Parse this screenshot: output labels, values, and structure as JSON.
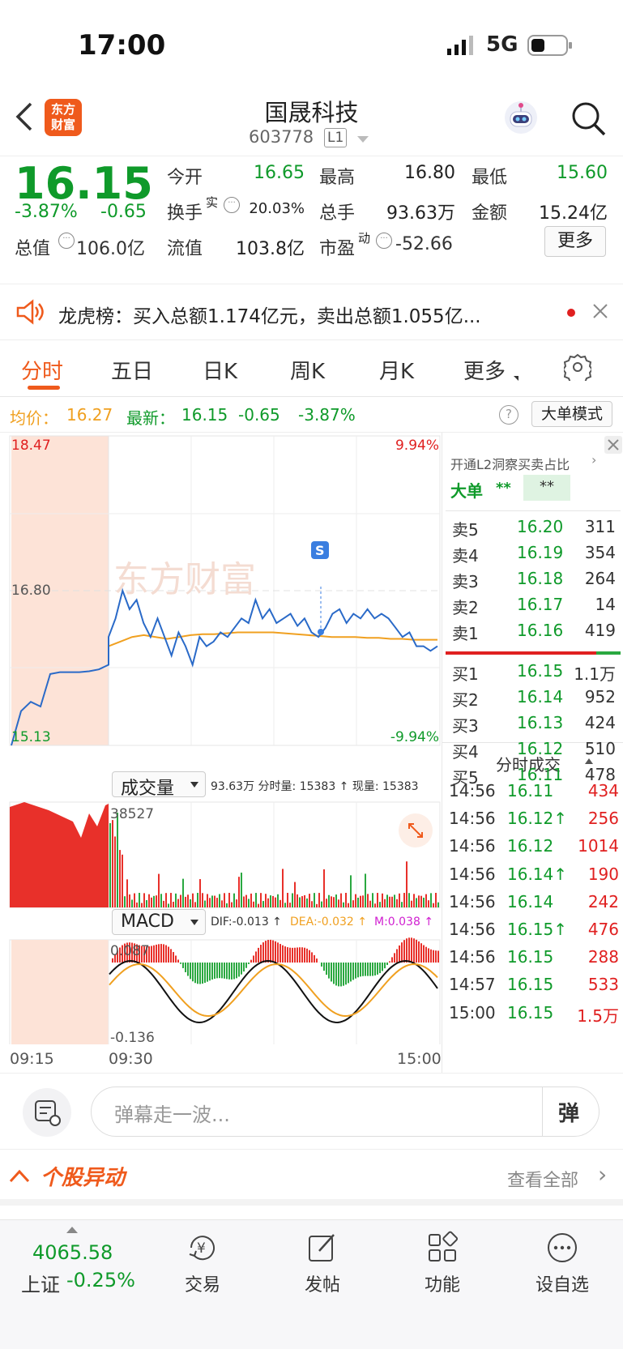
{
  "status": {
    "time": "17:00",
    "network": "5G"
  },
  "header": {
    "name": "国晟科技",
    "code": "603778",
    "level": "L1"
  },
  "quote": {
    "price": "16.15",
    "pct": "-3.87%",
    "change": "-0.65",
    "open_label": "今开",
    "open": "16.65",
    "high_label": "最高",
    "high": "16.80",
    "low_label": "最低",
    "low": "15.60",
    "turnover_label": "换手",
    "turnover_sup": "实",
    "turnover": "20.03%",
    "volume_label": "总手",
    "volume": "93.63万",
    "amount_label": "金额",
    "amount": "15.24亿",
    "mcap_label": "总值",
    "mcap": "106.0亿",
    "float_label": "流值",
    "float": "103.8亿",
    "pe_label": "市盈",
    "pe_sup": "动",
    "pe": "-52.66",
    "more": "更多"
  },
  "ticker": {
    "text": "龙虎榜：买入总额1.174亿元，卖出总额1.055亿..."
  },
  "tabs": [
    "分时",
    "五日",
    "日K",
    "周K",
    "月K",
    "更多"
  ],
  "info": {
    "avg_label": "均价：",
    "avg": "16.27",
    "last_label": "最新：",
    "last": "16.15",
    "chg": "-0.65",
    "pct": "-3.87%",
    "mode": "大单模式"
  },
  "chart": {
    "ymax": "18.47",
    "ymin": "15.13",
    "pct_max": "9.94%",
    "pct_min": "-9.94%",
    "ref": "16.80",
    "signal": "S",
    "vol_label": "成交量",
    "vol_summary": "93.63万 分时量: 15383 ↑ 现量: 15383",
    "vol_max": "38527",
    "macd_label": "MACD",
    "dif": "DIF:-0.013 ↑",
    "dea": "DEA:-0.032 ↑",
    "m": "M:0.038 ↑",
    "macd_max": "0.087",
    "macd_min": "-0.136",
    "t_start": "09:15",
    "t_open": "09:30",
    "t_end": "15:00",
    "watermark": "东方财富"
  },
  "chart_data": {
    "type": "line",
    "title": "",
    "ylim": [
      15.13,
      18.47
    ],
    "series": [
      {
        "name": "price",
        "values": [
          15.13,
          15.5,
          15.6,
          15.55,
          15.9,
          15.92,
          15.92,
          15.92,
          15.93,
          15.95,
          16.0,
          16.3,
          16.5,
          16.8,
          16.6,
          16.7,
          16.45,
          16.3,
          16.5,
          16.3,
          16.1,
          16.35,
          16.2,
          16.0,
          16.3,
          16.2,
          16.25,
          16.35,
          16.3,
          16.4,
          16.5,
          16.45,
          16.7,
          16.5,
          16.6,
          16.45,
          16.5,
          16.55,
          16.42,
          16.5,
          16.35,
          16.3,
          16.4,
          16.55,
          16.6,
          16.45,
          16.55,
          16.5,
          16.6,
          16.5,
          16.55,
          16.5,
          16.4,
          16.3,
          16.35,
          16.2,
          16.2,
          16.15,
          16.2
        ]
      },
      {
        "name": "均价",
        "values": [
          16.2,
          16.25,
          16.3,
          16.32,
          16.3,
          16.28,
          16.3,
          16.32,
          16.33,
          16.33,
          16.34,
          16.35,
          16.35,
          16.35,
          16.35,
          16.34,
          16.33,
          16.32,
          16.31,
          16.3,
          16.3,
          16.3,
          16.29,
          16.29,
          16.28,
          16.28,
          16.27,
          16.27,
          16.27
        ]
      }
    ]
  },
  "orderbook": {
    "promo": "开通L2洞察买卖占比",
    "big_label": "大单",
    "big_val1": "**",
    "big_val2": "**",
    "sells": [
      {
        "label": "卖5",
        "price": "16.20",
        "vol": "311"
      },
      {
        "label": "卖4",
        "price": "16.19",
        "vol": "354"
      },
      {
        "label": "卖3",
        "price": "16.18",
        "vol": "264"
      },
      {
        "label": "卖2",
        "price": "16.17",
        "vol": "14"
      },
      {
        "label": "卖1",
        "price": "16.16",
        "vol": "419"
      }
    ],
    "buys": [
      {
        "label": "买1",
        "price": "16.15",
        "vol": "1.1万"
      },
      {
        "label": "买2",
        "price": "16.14",
        "vol": "952"
      },
      {
        "label": "买3",
        "price": "16.13",
        "vol": "424"
      },
      {
        "label": "买4",
        "price": "16.12",
        "vol": "510"
      },
      {
        "label": "买5",
        "price": "16.11",
        "vol": "478"
      }
    ],
    "trades_title": "分时成交",
    "trades": [
      {
        "time": "14:56",
        "price": "16.11",
        "vol": "434"
      },
      {
        "time": "14:56",
        "price": "16.12↑",
        "vol": "256"
      },
      {
        "time": "14:56",
        "price": "16.12",
        "vol": "1014"
      },
      {
        "time": "14:56",
        "price": "16.14↑",
        "vol": "190"
      },
      {
        "time": "14:56",
        "price": "16.14",
        "vol": "242"
      },
      {
        "time": "14:56",
        "price": "16.15↑",
        "vol": "476"
      },
      {
        "time": "14:56",
        "price": "16.15",
        "vol": "288"
      },
      {
        "time": "14:57",
        "price": "16.15",
        "vol": "533"
      },
      {
        "time": "15:00",
        "price": "16.15",
        "vol": "1.5万"
      }
    ]
  },
  "danmu": {
    "placeholder": "弹幕走一波...",
    "btn": "弹"
  },
  "movers": {
    "title": "个股异动",
    "view_all": "查看全部"
  },
  "bottom": {
    "index_value": "4065.58",
    "index_name": "上证",
    "index_pct": "-0.25%",
    "items": [
      "交易",
      "发帖",
      "功能",
      "设自选"
    ]
  }
}
